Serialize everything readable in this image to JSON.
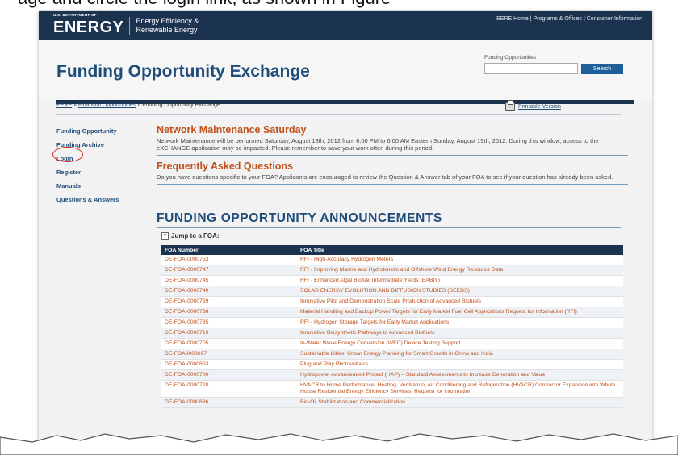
{
  "caption": "age and circle the login link, as shown in Figure",
  "header": {
    "logo_top": "U.S. DEPARTMENT OF",
    "logo_main": "ENERGY",
    "logo_sub1": "Energy Efficiency &",
    "logo_sub2": "Renewable Energy",
    "top_links": "EERE Home | Programs & Offices | Consumer Information"
  },
  "site_title": "Funding Opportunity Exchange",
  "search": {
    "label": "Funding Opportunities",
    "value": "",
    "button": "Search"
  },
  "breadcrumb": {
    "link1": "EERE",
    "sep": " » ",
    "link2": "Financial Opportunities",
    "current": "Funding Opportunity Exchange"
  },
  "printable": "Printable Version",
  "sidebar": {
    "items": [
      {
        "label": "Funding Opportunity"
      },
      {
        "label": "Funding Archive"
      },
      {
        "label": "Login"
      },
      {
        "label": "Register"
      },
      {
        "label": "Manuals"
      },
      {
        "label": "Questions & Answers"
      }
    ]
  },
  "notice": {
    "title": "Network Maintenance Saturday",
    "text": "Network Maintenance will be performed Saturday, August 18th, 2012 from 6:00 PM to 6:00 AM Eastern Sunday, August 19th, 2012. During this window, access to the eXCHANGE application may be impacted. Please remember to save your work often during this period."
  },
  "faq": {
    "title": "Frequently Asked Questions",
    "text": "Do you have questions specific to your FOA? Applicants are encouraged to review the Question & Answer tab of your FOA to see if your question has already been asked."
  },
  "foa": {
    "heading": "FUNDING OPPORTUNITY ANNOUNCEMENTS",
    "jump_label": "Jump to a FOA:",
    "col_number": "FOA Number",
    "col_title": "FOA Title",
    "rows": [
      {
        "num": "DE-FOA-0000753",
        "title": "RFI - High-Accuracy Hydrogen Meters"
      },
      {
        "num": "DE-FOA-0000747",
        "title": "RFI - Improving Marine and Hydrokinetic and Offshore Wind Energy Resource Data"
      },
      {
        "num": "DE-FOA-0000745",
        "title": "RFI - Enhanced Algal Biofuel Intermediate Yields (EABIY)"
      },
      {
        "num": "DE-FOA-0000740",
        "title": "SOLAR ENERGY EVOLUTION AND DIFFUSION STUDIES (SEEDS)"
      },
      {
        "num": "DE-FOA-0000739",
        "title": "Innovative Pilot and Demonstration Scale Production of Advanced Biofuels"
      },
      {
        "num": "DE-FOA-0000738",
        "title": "Material Handling and Backup Power Targets for Early Market Fuel Cell Applications Request for Information (RFI)"
      },
      {
        "num": "DE-FOA-0000735",
        "title": "RFI - Hydrogen Storage Targets for Early Market Applications"
      },
      {
        "num": "DE-FOA-0000719",
        "title": "Innovative Biosynthetic Pathways to Advanced Biofuels"
      },
      {
        "num": "DE-FOA-0000705",
        "title": "In-Water Wave Energy Conversion (WEC) Device Testing Support"
      },
      {
        "num": "DE-FOA0000697",
        "title": "Sustainable Cities: Urban Energy Planning for Smart Growth in China and India"
      },
      {
        "num": "DE-FOA-0000653",
        "title": "Plug and Play Photovoltaics"
      },
      {
        "num": "DE-FOA-0000700",
        "title": "Hydropower Advancement Project (HAP) – Standard Assessments to Increase Generation and Value"
      },
      {
        "num": "DE-FOA-0000720",
        "title": "HVACR to Home Performance: Heating, Ventilation, Air Conditioning and Refrigeration (HVACR) Contractor Expansion into Whole House Residential Energy Efficiency Services, Request for Information"
      },
      {
        "num": "DE-FOA-0000686",
        "title": "Bio-Oil Stabilization and Commercialization"
      }
    ]
  }
}
